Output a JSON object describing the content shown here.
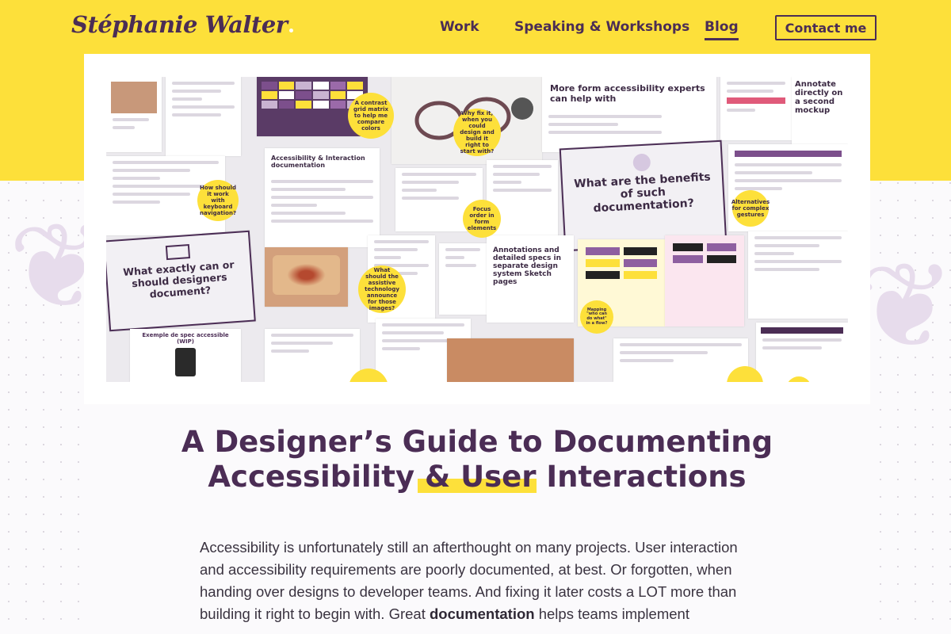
{
  "site": {
    "logo_text": "Stéphanie Walter"
  },
  "nav": {
    "items": [
      {
        "label": "Work",
        "active": false
      },
      {
        "label": "Speaking & Workshops",
        "active": false
      },
      {
        "label": "Blog",
        "active": true
      }
    ],
    "contact_label": "Contact me"
  },
  "hero": {
    "bubbles": [
      "A contrast grid matrix to help me compare colors",
      "Why fix it, when you could design and build it right to start with?",
      "How should it work with keyboard navigation?",
      "Focus order in form elements",
      "Alternatives for complex gestures",
      "What should the assistive technology announce for those images?",
      "Mapping \"who can do what\" in a flow?"
    ],
    "slides": {
      "benefits": "What are the benefits of such documentation?",
      "what_document": "What exactly can or should designers document?",
      "annotations": "Annotations and detailed specs in separate design system Sketch pages",
      "accessibility_experts": "More form accessibility experts can help with",
      "annotate_second": "Annotate directly on a second mockup",
      "doc_title": "Accessibility & Interaction documentation",
      "example_spec": "Exemple de spec accessible (WIP)"
    }
  },
  "article": {
    "title": "A Designer’s Guide to Documenting Accessibility & User Interactions",
    "intro_1": "Accessibility is unfortunately still an afterthought on many projects. User interaction and accessibility requirements are poorly documented, at best. Or forgotten, when handing over designs to developer teams. And fixing it later costs a LOT more than building it right to begin with. Great ",
    "intro_bold": "documentation",
    "intro_2": " helps teams implement"
  },
  "colors": {
    "brand_yellow": "#fde03a",
    "brand_purple": "#4b2d55"
  }
}
